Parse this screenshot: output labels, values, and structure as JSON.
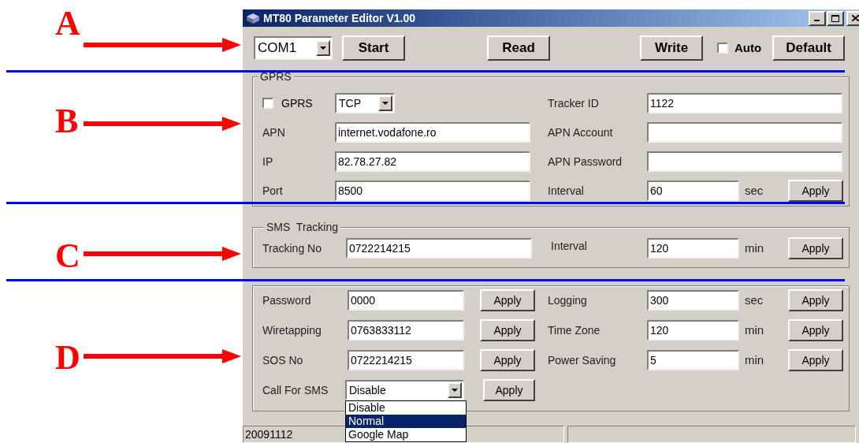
{
  "annotations": [
    {
      "letter": "A"
    },
    {
      "letter": "B"
    },
    {
      "letter": "C"
    },
    {
      "letter": "D"
    }
  ],
  "window": {
    "title": "MT80 Parameter Editor V1.00"
  },
  "toolbar": {
    "port": "COM1",
    "start": "Start",
    "read": "Read",
    "write": "Write",
    "auto": {
      "label": "Auto",
      "checked": false
    },
    "default": "Default"
  },
  "gprs": {
    "title": "GPRS",
    "enable": {
      "label": "GPRS",
      "checked": false
    },
    "protocol": "TCP",
    "left_fields": [
      {
        "label": "APN",
        "value": "internet.vodafone.ro"
      },
      {
        "label": "IP",
        "value": "82.78.27.82"
      },
      {
        "label": "Port",
        "value": "8500"
      }
    ],
    "right_fields": [
      {
        "label": "Tracker ID",
        "value": "1122"
      },
      {
        "label": "APN Account"
      },
      {
        "label": "APN Password"
      },
      {
        "label": "Interval",
        "value": "60",
        "unit": "sec",
        "button": "Apply"
      }
    ]
  },
  "sms_tracking": {
    "title": "SMS  Tracking",
    "tracking_no": {
      "label": "Tracking No",
      "value": "0722214215"
    },
    "interval": {
      "label": "Interval",
      "value": "120",
      "unit": "min",
      "button": "Apply"
    }
  },
  "settings": {
    "left": [
      {
        "label": "Password",
        "value": "0000",
        "button": "Apply"
      },
      {
        "label": "Wiretapping",
        "value": "0763833112",
        "button": "Apply"
      },
      {
        "label": "SOS No",
        "value": "0722214215",
        "button": "Apply"
      }
    ],
    "right": [
      {
        "label": "Logging",
        "value": "300",
        "unit": "sec",
        "button": "Apply"
      },
      {
        "label": "Time Zone",
        "value": "120",
        "unit": "min",
        "button": "Apply"
      },
      {
        "label": "Power Saving",
        "value": "5",
        "unit": "min",
        "button": "Apply"
      }
    ],
    "call_for_sms": {
      "label": "Call For SMS",
      "value": "Disable",
      "button": "Apply",
      "options": [
        {
          "label": "Disable",
          "highlighted": false
        },
        {
          "label": "Normal",
          "highlighted": true
        },
        {
          "label": "Google Map",
          "highlighted": false
        }
      ]
    }
  },
  "status_bar": [
    "20091112"
  ]
}
